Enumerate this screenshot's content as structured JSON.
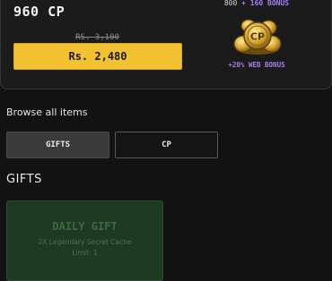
{
  "offer": {
    "title": "960 CP",
    "original_price": "RS. 3,100",
    "price_label": "Rs. 2,480",
    "bonus_base": "800",
    "bonus_sep": " + ",
    "bonus_extra": "160 BONUS",
    "web_bonus": "+20% WEB BONUS",
    "coin_icon_label": "CP",
    "coin_icon": "cp-coin-stack-icon"
  },
  "browse": {
    "title": "Browse all items",
    "tabs": [
      {
        "label": "GIFTS",
        "active": true
      },
      {
        "label": "CP",
        "active": false
      }
    ]
  },
  "gifts": {
    "heading": "GIFTS",
    "items": [
      {
        "name": "DAILY GIFT",
        "description": "2X Legendary Secret Cache",
        "limit": "Limit: 1"
      }
    ]
  },
  "colors": {
    "background": "#121212",
    "buy_button": "#f2c232",
    "accent_purple": "#a77cf2",
    "gift_card": "#1f3a23"
  }
}
